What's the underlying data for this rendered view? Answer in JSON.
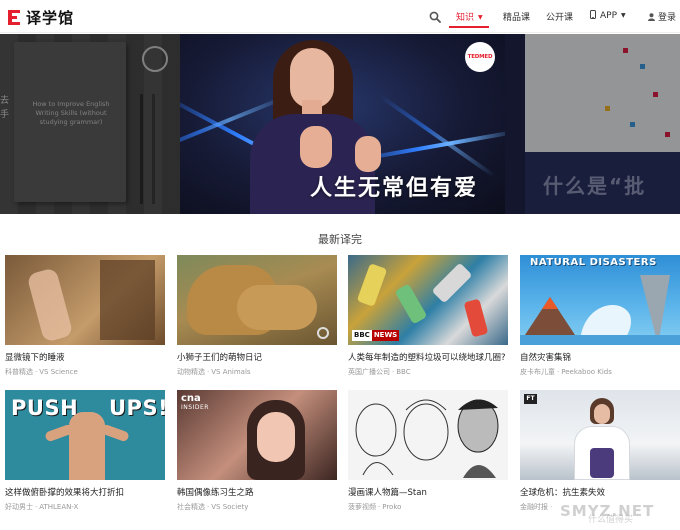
{
  "nav": {
    "logo_text": "译学馆",
    "items": [
      {
        "label": "知识",
        "active": true,
        "has_caret": true
      },
      {
        "label": "精品课",
        "active": false,
        "has_caret": false
      },
      {
        "label": "公开课",
        "active": false,
        "has_caret": false
      },
      {
        "label": "APP",
        "active": false,
        "has_caret": true
      },
      {
        "label": "登录",
        "active": false,
        "has_caret": false
      }
    ],
    "accent_color": "#e4202f"
  },
  "banner": {
    "left_slide_text": "How to Improve English Writing Skills (without studying grammar)",
    "left_side_glyph": "去手",
    "center_logo": "TEDMED",
    "center_caption": "人生无常但有爱",
    "right_caption": "什么是“批"
  },
  "section": {
    "title": "最新译完",
    "cards": [
      {
        "title": "显微镜下的睡液",
        "channel": "科普精选",
        "source": "VS Science"
      },
      {
        "title": "小狮子王们的萌物日记",
        "channel": "动物精选",
        "source": "VS Animals"
      },
      {
        "title": "人类每年制造的塑料垃圾可以绕地球几圈?",
        "channel": "英国广播公司",
        "source": "BBC",
        "badge_left": "BBC",
        "badge_right": "NEWS"
      },
      {
        "title": "自然灾害集锦",
        "channel": "皮卡布儿童",
        "source": "Peekaboo Kids",
        "thumb_text": "NATURAL DISASTERS"
      },
      {
        "title": "这样做俯卧撑的效果将大打折扣",
        "channel": "好动男士",
        "source": "ATHLEAN-X",
        "thumb_left": "PUSH",
        "thumb_right": "UPS!"
      },
      {
        "title": "韩国偶像练习生之路",
        "channel": "社会精选",
        "source": "VS Society",
        "badge_top": "cna",
        "badge_bottom": "INSIDER"
      },
      {
        "title": "漫画课人物篇—Stan",
        "channel": "菠萝视频",
        "source": "Proko"
      },
      {
        "title": "全球危机：抗生素失效",
        "channel": "金融时报",
        "source": "",
        "thumb_logo": "FT"
      }
    ]
  },
  "watermark": {
    "main": "SMYZ.NET",
    "sub": "什么值得买"
  }
}
